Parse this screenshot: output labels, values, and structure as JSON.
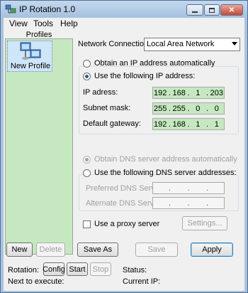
{
  "window": {
    "title": "IP Rotation 1.0"
  },
  "menu": {
    "items": [
      "View",
      "Tools",
      "Help"
    ]
  },
  "profiles": {
    "header": "Profiles",
    "items": [
      {
        "label": "New Profile"
      }
    ],
    "new_label": "New",
    "delete_label": "Delete"
  },
  "network": {
    "label": "Network Connections:",
    "selected": "Local Area Network"
  },
  "ip": {
    "auto_label": "Obtain an IP address automatically",
    "manual_label": "Use the following IP address:",
    "address_label": "IP adress:",
    "address": [
      "192",
      "168",
      "1",
      "203"
    ],
    "subnet_label": "Subnet mask:",
    "subnet": [
      "255",
      "255",
      "0",
      "0"
    ],
    "gateway_label": "Default gateway:",
    "gateway": [
      "192",
      "168",
      "1",
      "1"
    ]
  },
  "dns": {
    "auto_label": "Obtain DNS server address automatically",
    "manual_label": "Use the following DNS server addresses:",
    "preferred_label": "Preferred DNS Server:",
    "alternate_label": "Alternate DNS Server:",
    "preferred": [
      "",
      "",
      "",
      ""
    ],
    "alternate": [
      "",
      "",
      "",
      ""
    ]
  },
  "proxy": {
    "label": "Use a proxy server",
    "settings_label": "Settings..."
  },
  "actions": {
    "save_as_label": "Save As",
    "save_label": "Save",
    "apply_label": "Apply"
  },
  "rotation": {
    "label": "Rotation:",
    "config_label": "Config",
    "start_label": "Start",
    "stop_label": "Stop",
    "next_label": "Next to execute:"
  },
  "status": {
    "status_label": "Status:",
    "current_ip_label": "Current IP:"
  },
  "colors": {
    "profile_list_bg": "#c5e8c0",
    "ip_field_bg": "#c5e8c0",
    "titlebar": "#a9c3de"
  }
}
